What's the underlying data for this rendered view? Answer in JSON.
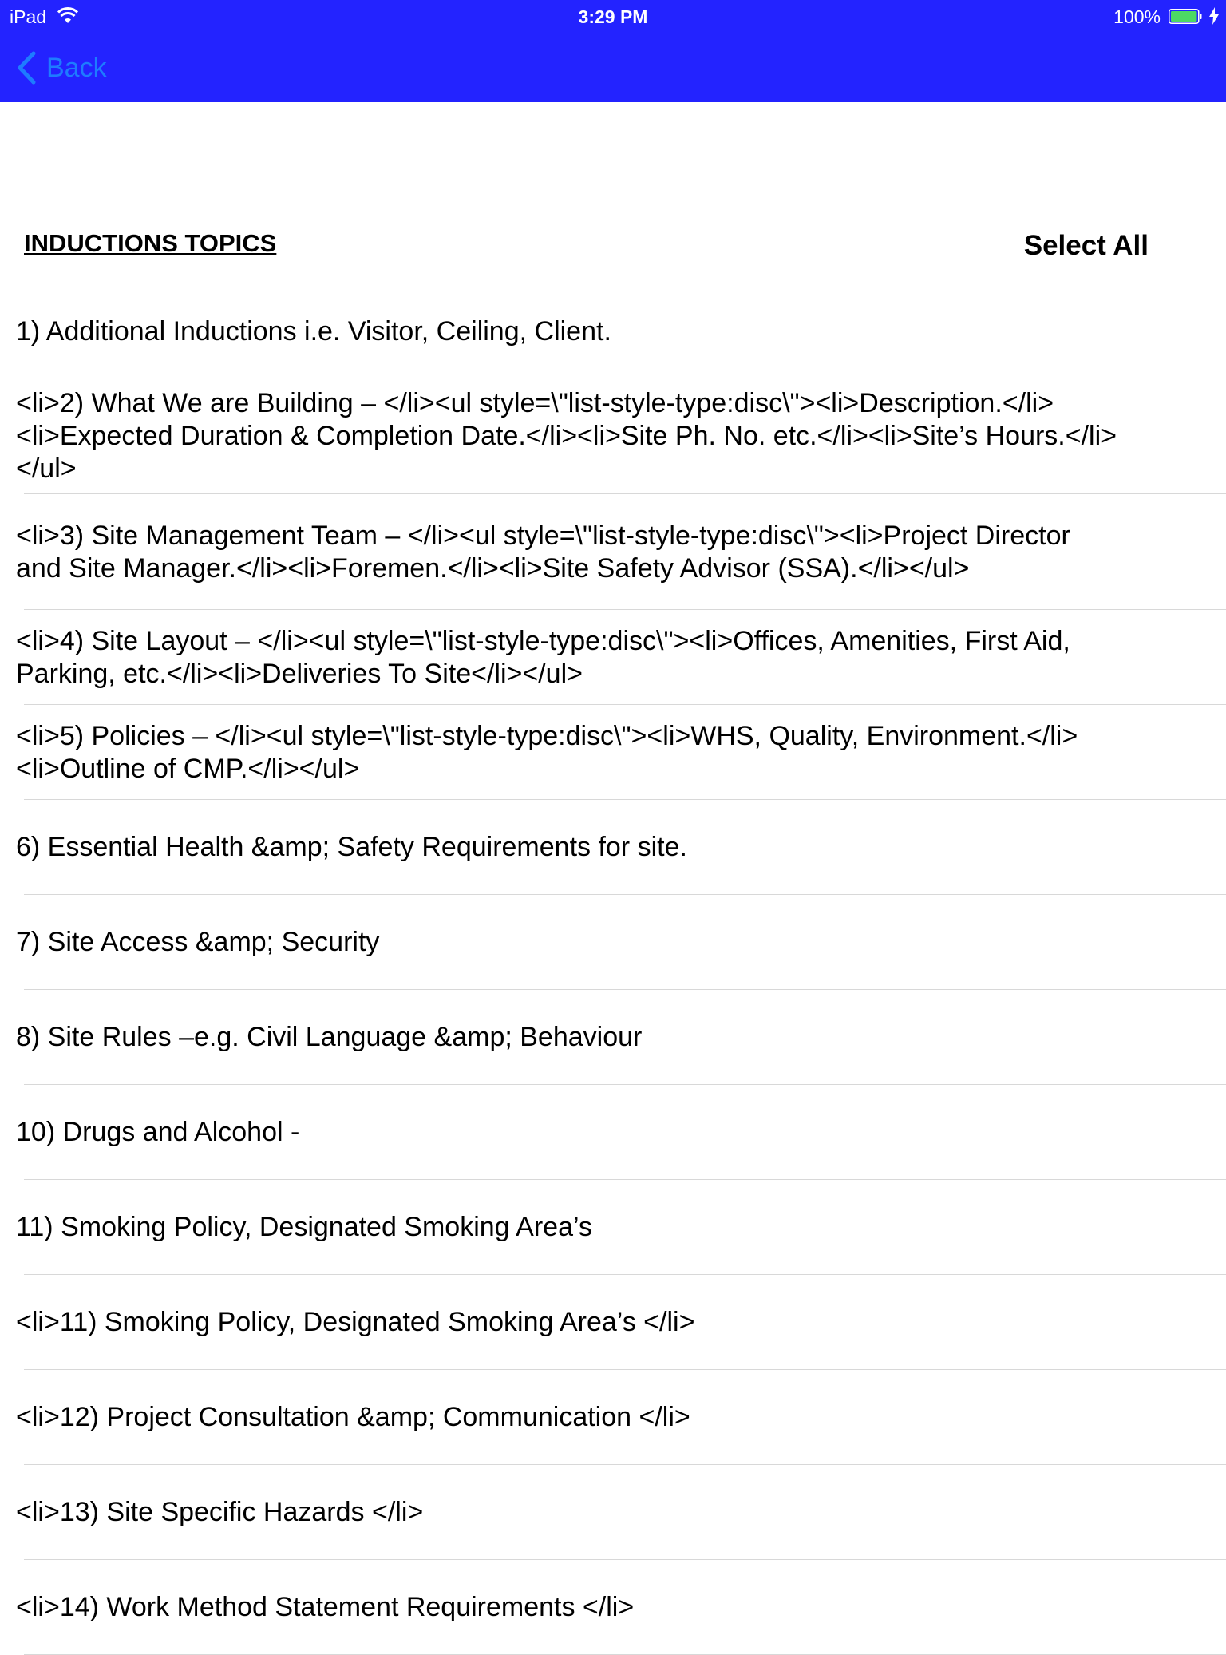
{
  "status_bar": {
    "device": "iPad",
    "time": "3:29 PM",
    "battery": "100%"
  },
  "nav": {
    "back_label": "Back",
    "bar_color": "#2323ff",
    "back_color": "#1e7cff"
  },
  "header": {
    "title": "INDUCTIONS TOPICS",
    "select_all": "Select All"
  },
  "topics": [
    "1) Additional Inductions i.e. Visitor, Ceiling, Client.",
    "<li>2) What We are Building – </li><ul style=\\\"list-style-type:disc\\\"><li>Description.</li><li>Expected Duration & Completion Date.</li><li>Site Ph. No. etc.</li><li>Site’s Hours.</li></ul>",
    "<li>3) Site Management Team – </li><ul style=\\\"list-style-type:disc\\\"><li>Project Director and Site Manager.</li><li>Foremen.</li><li>Site Safety Advisor (SSA).</li></ul>",
    "<li>4) Site Layout –  </li><ul style=\\\"list-style-type:disc\\\"><li>Offices, Amenities, First Aid, Parking, etc.</li><li>Deliveries To Site</li></ul>",
    "<li>5) Policies –  </li><ul style=\\\"list-style-type:disc\\\"><li>WHS, Quality, Environment.</li><li>Outline of CMP.</li></ul>",
    "6) Essential Health &amp; Safety Requirements for site.",
    "7) Site Access &amp; Security",
    "8) Site Rules –e.g. Civil  Language &amp; Behaviour",
    "10) Drugs and Alcohol -",
    "11) Smoking Policy, Designated Smoking Area’s",
    "<li>11) Smoking Policy, Designated Smoking Area’s </li>",
    "<li>12) Project Consultation &amp; Communication </li>",
    "<li>13) Site Specific Hazards </li>",
    "<li>14) Work Method Statement Requirements </li>"
  ]
}
